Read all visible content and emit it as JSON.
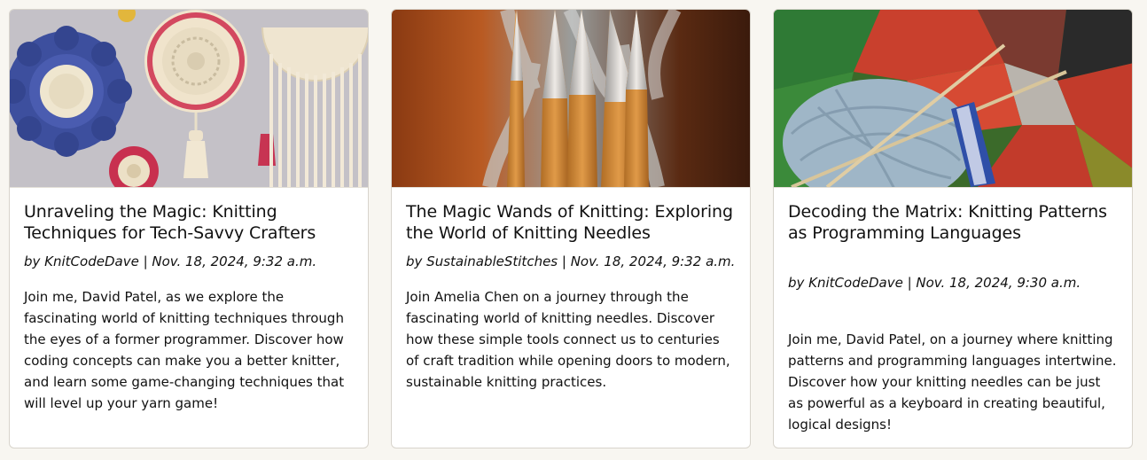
{
  "posts": [
    {
      "title": "Unraveling the Magic: Knitting Techniques for Tech-Savvy Crafters",
      "meta": "by KnitCodeDave | Nov. 18, 2024, 9:32 a.m.",
      "excerpt": "Join me, David Patel, as we explore the fascinating world of knitting techniques through the eyes of a former programmer. Discover how coding concepts can make you a better knitter, and learn some game-changing techniques that will level up your yarn game!",
      "image": "crochet-mandala-wall-hanging-photo"
    },
    {
      "title": "The Magic Wands of Knitting: Exploring the World of Knitting Needles",
      "meta": "by SustainableStitches | Nov. 18, 2024, 9:32 a.m.",
      "excerpt": "Join Amelia Chen on a journey through the fascinating world of knitting needles. Discover how these simple tools connect us to centuries of craft tradition while opening doors to modern, sustainable knitting practices.",
      "image": "bamboo-knitting-needles-photo"
    },
    {
      "title": "Decoding the Matrix: Knitting Patterns as Programming Languages",
      "meta": "by KnitCodeDave | Nov. 18, 2024, 9:30 a.m.",
      "excerpt": "Join me, David Patel, on a journey where knitting patterns and programming languages intertwine. Discover how your knitting needles can be just as powerful as a keyboard in creating beautiful, logical designs!",
      "image": "yarn-ball-and-knitted-patchwork-photo"
    }
  ],
  "colors": {
    "page_background": "#f8f6f1",
    "card_background": "#ffffff",
    "card_border": "#d8d4cc",
    "text": "#111111"
  }
}
